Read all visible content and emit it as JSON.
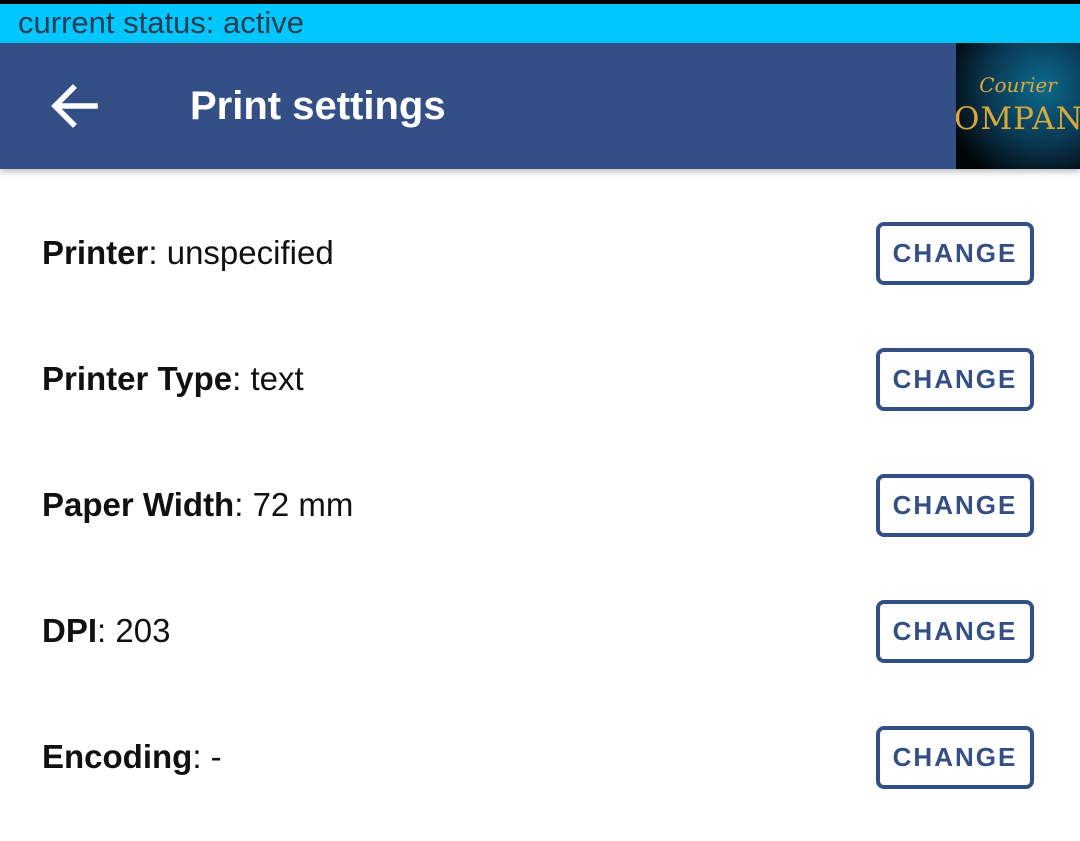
{
  "status_bar": {
    "text": "current status: active"
  },
  "app_bar": {
    "title": "Print settings",
    "back_icon": "arrow-left-icon",
    "logo": {
      "line1": "Courier",
      "line2": "OMPAN"
    }
  },
  "settings": [
    {
      "label": "Printer",
      "separator": ": ",
      "value": "unspecified",
      "button": "CHANGE"
    },
    {
      "label": "Printer Type",
      "separator": ": ",
      "value": "text",
      "button": "CHANGE"
    },
    {
      "label": "Paper Width",
      "separator": ": ",
      "value": "72 mm",
      "button": "CHANGE"
    },
    {
      "label": "DPI",
      "separator": ": ",
      "value": "203",
      "button": "CHANGE"
    },
    {
      "label": "Encoding",
      "separator": ": ",
      "value": "-",
      "button": "CHANGE"
    }
  ],
  "colors": {
    "status_bar_bg": "#00c8ff",
    "app_bar_bg": "#344f86",
    "accent": "#344f86",
    "text": "#111111"
  }
}
